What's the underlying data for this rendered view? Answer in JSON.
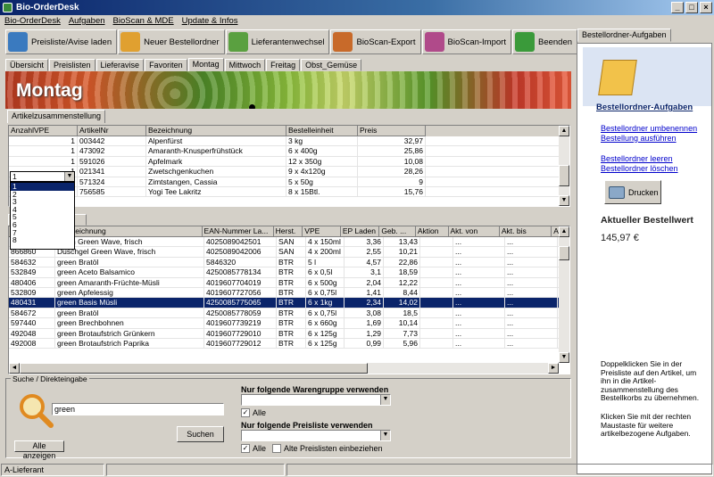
{
  "window": {
    "title": "Bio-OrderDesk"
  },
  "menu": [
    "Bio-OrderDesk",
    "Aufgaben",
    "BioScan & MDE",
    "Update & Infos"
  ],
  "toolbar": [
    {
      "label": "Preisliste/Avise laden",
      "icon": "price-list-icon",
      "color": "#3a7abf"
    },
    {
      "label": "Neuer Bestellordner",
      "icon": "new-folder-icon",
      "color": "#e0a030"
    },
    {
      "label": "Lieferantenwechsel",
      "icon": "supplier-change-icon",
      "color": "#5aa040"
    },
    {
      "label": "BioScan-Export",
      "icon": "bioscan-export-icon",
      "color": "#c86a2a"
    },
    {
      "label": "BioScan-Import",
      "icon": "bioscan-import-icon",
      "color": "#b04a8a"
    },
    {
      "label": "Beenden",
      "icon": "exit-icon",
      "color": "#3a9a3a"
    }
  ],
  "day_tabs": [
    "Übersicht",
    "Preislisten",
    "Lieferavise",
    "Favoriten",
    "Montag",
    "Mittwoch",
    "Freitag",
    "Obst_Gemüse"
  ],
  "active_tab": "Montag",
  "banner_title": "Montag",
  "sub_tab": "Artikelzusammenstellung",
  "order_grid": {
    "headers": [
      "AnzahlVPE",
      "ArtikelNr",
      "Bezeichnung",
      "Bestelleinheit",
      "Preis"
    ],
    "rows": [
      [
        "1",
        "003442",
        "Alpenfürst",
        "3 kg",
        "32,97"
      ],
      [
        "1",
        "473092",
        "Amaranth-Knusperfrühstück",
        "6 x 400g",
        "25,86"
      ],
      [
        "1",
        "591026",
        "Apfelmark",
        "12 x 350g",
        "10,08"
      ],
      [
        "1",
        "021341",
        "Zwetschgenkuchen",
        "9 x 4x120g",
        "28,26"
      ],
      [
        "",
        "571324",
        "Zimtstangen, Cassia",
        "5 x 50g",
        "9"
      ],
      [
        "",
        "756585",
        "Yogi Tee Lakritz",
        "8 x 15Btl.",
        "15,76"
      ]
    ]
  },
  "qty_dropdown": {
    "value": "1",
    "options": [
      "1",
      "2",
      "3",
      "4",
      "5",
      "6",
      "7",
      "8"
    ]
  },
  "catalog_grid": {
    "headers": [
      "",
      "...bezeichnung",
      "EAN-Nummer La...",
      "Herst.",
      "VPE",
      "EP Laden",
      "Geb. ...",
      "Aktion",
      "Akt. von",
      "Akt. bis",
      "Akt"
    ],
    "rows": [
      [
        "",
        "...tion Green Wave, frisch",
        "4025089042501",
        "SAN",
        "4 x 150ml",
        "3,36",
        "13,43",
        "",
        "...",
        "..."
      ],
      [
        "866860",
        "Duschgel Green Wave, frisch",
        "4025089042006",
        "SAN",
        "4 x 200ml",
        "2,55",
        "10,21",
        "",
        "...",
        "..."
      ],
      [
        "584632",
        "green  Bratöl",
        "5846320",
        "BTR",
        "5 l",
        "4,57",
        "22,86",
        "",
        "...",
        "..."
      ],
      [
        "532849",
        "green Aceto Balsamico",
        "4250085778134",
        "BTR",
        "6 x 0,5l",
        "3,1",
        "18,59",
        "",
        "...",
        "..."
      ],
      [
        "480406",
        "green Amaranth-Früchte-Müsli",
        "4019607704019",
        "BTR",
        "6 x 500g",
        "2,04",
        "12,22",
        "",
        "...",
        "..."
      ],
      [
        "532809",
        "green Apfelessig",
        "4019607727056",
        "BTR",
        "6 x 0,75l",
        "1,41",
        "8,44",
        "",
        "...",
        "..."
      ],
      [
        "480431",
        "green Basis Müsli",
        "4250085775065",
        "BTR",
        "6 x 1kg",
        "2,34",
        "14,02",
        "",
        "...",
        "..."
      ],
      [
        "584672",
        "green Bratöl",
        "4250085778059",
        "BTR",
        "6 x 0,75l",
        "3,08",
        "18,5",
        "",
        "...",
        "..."
      ],
      [
        "597440",
        "green Brechbohnen",
        "4019607739219",
        "BTR",
        "6 x 660g",
        "1,69",
        "10,14",
        "",
        "...",
        "..."
      ],
      [
        "492048",
        "green Brotaufstrich Grünkern",
        "4019607729010",
        "BTR",
        "6 x 125g",
        "1,29",
        "7,73",
        "",
        "...",
        "..."
      ],
      [
        "492008",
        "green Brotaufstrich Paprika",
        "4019607729012",
        "BTR",
        "6 x 125g",
        "0,99",
        "5,96",
        "",
        "...",
        "..."
      ]
    ],
    "selected_index": 6
  },
  "search": {
    "legend": "Suche / Direkteingabe",
    "value": "green",
    "search_button": "Suchen",
    "show_all_button": "Alle anzeigen",
    "group_label": "Nur folgende Warengruppe verwenden",
    "group_all": "Alle",
    "pricelist_label": "Nur folgende Preisliste verwenden",
    "pricelist_all": "Alle",
    "old_pricelists": "Alte Preislisten einbeziehen"
  },
  "status": {
    "left": "A-Lieferant"
  },
  "panel": {
    "tab": "Bestellordner-Aufgaben",
    "title": "Bestellordner-Aufgaben",
    "links": [
      "Bestellordner umbenennen",
      "Bestellung ausführen",
      "Bestellordner leeren",
      "Bestellordner löschen"
    ],
    "print_button": "Drucken",
    "total_label": "Aktueller Bestellwert",
    "total_value": "145,97 €",
    "help1": "Doppelklicken Sie in der Preisliste auf den Artikel, um ihn in die Artikel-zusammenstellung des Bestellkorbs zu übernehmen.",
    "help2": "Klicken Sie mit der rechten Maustaste für weitere artikelbezogene Aufgaben."
  }
}
